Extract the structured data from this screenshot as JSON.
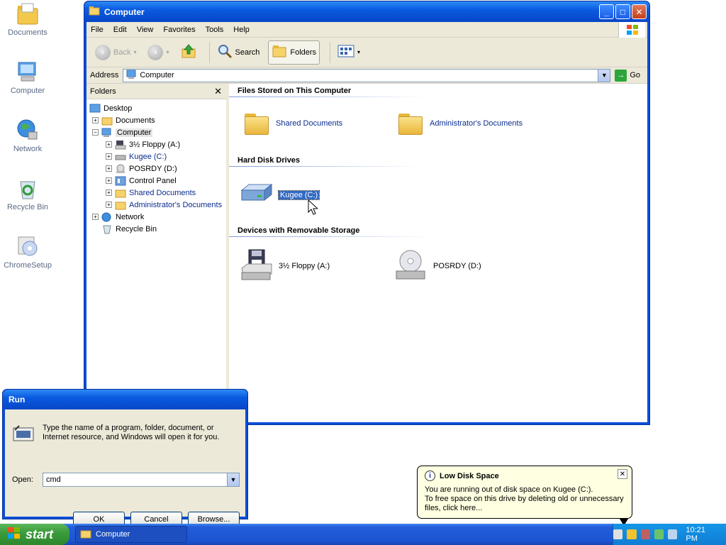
{
  "desktop": {
    "icons": [
      {
        "label": "Documents"
      },
      {
        "label": "Computer"
      },
      {
        "label": "Network"
      },
      {
        "label": "Recycle Bin"
      },
      {
        "label": "ChromeSetup"
      }
    ]
  },
  "window": {
    "title": "Computer",
    "menu": [
      "File",
      "Edit",
      "View",
      "Favorites",
      "Tools",
      "Help"
    ],
    "toolbar": {
      "back": "Back",
      "search": "Search",
      "folders": "Folders"
    },
    "address": {
      "label": "Address",
      "value": "Computer",
      "go": "Go"
    },
    "folders_pane": {
      "title": "Folders",
      "tree": [
        {
          "label": "Desktop",
          "level": 0,
          "expander": ""
        },
        {
          "label": "Documents",
          "level": 1,
          "expander": "+"
        },
        {
          "label": "Computer",
          "level": 1,
          "expander": "-"
        },
        {
          "label": "3½ Floppy (A:)",
          "level": 2,
          "expander": "+"
        },
        {
          "label": "Kugee (C:)",
          "level": 2,
          "expander": "+"
        },
        {
          "label": "POSRDY (D:)",
          "level": 2,
          "expander": "+"
        },
        {
          "label": "Control Panel",
          "level": 2,
          "expander": "+"
        },
        {
          "label": "Shared Documents",
          "level": 2,
          "expander": "+"
        },
        {
          "label": "Administrator's Documents",
          "level": 2,
          "expander": "+"
        },
        {
          "label": "Network",
          "level": 1,
          "expander": "+"
        },
        {
          "label": "Recycle Bin",
          "level": 1,
          "expander": ""
        }
      ]
    },
    "groups": {
      "files": {
        "title": "Files Stored on This Computer",
        "items": [
          "Shared Documents",
          "Administrator's Documents"
        ]
      },
      "disks": {
        "title": "Hard Disk Drives",
        "items": [
          "Kugee (C:)"
        ]
      },
      "removable": {
        "title": "Devices with Removable Storage",
        "items": [
          "3½ Floppy (A:)",
          "POSRDY (D:)"
        ]
      }
    }
  },
  "run_dialog": {
    "title": "Run",
    "description": "Type the name of a program, folder, document, or Internet resource, and Windows will open it for you.",
    "open_label": "Open:",
    "open_value": "cmd",
    "ok": "OK",
    "cancel": "Cancel",
    "browse": "Browse..."
  },
  "balloon": {
    "title": "Low Disk Space",
    "line1": "You are running out of disk space on Kugee (C:).",
    "line2": "To free space on this drive by deleting old or unnecessary files, click here..."
  },
  "taskbar": {
    "start": "start",
    "task": "Computer",
    "clock": "10:21 PM"
  }
}
